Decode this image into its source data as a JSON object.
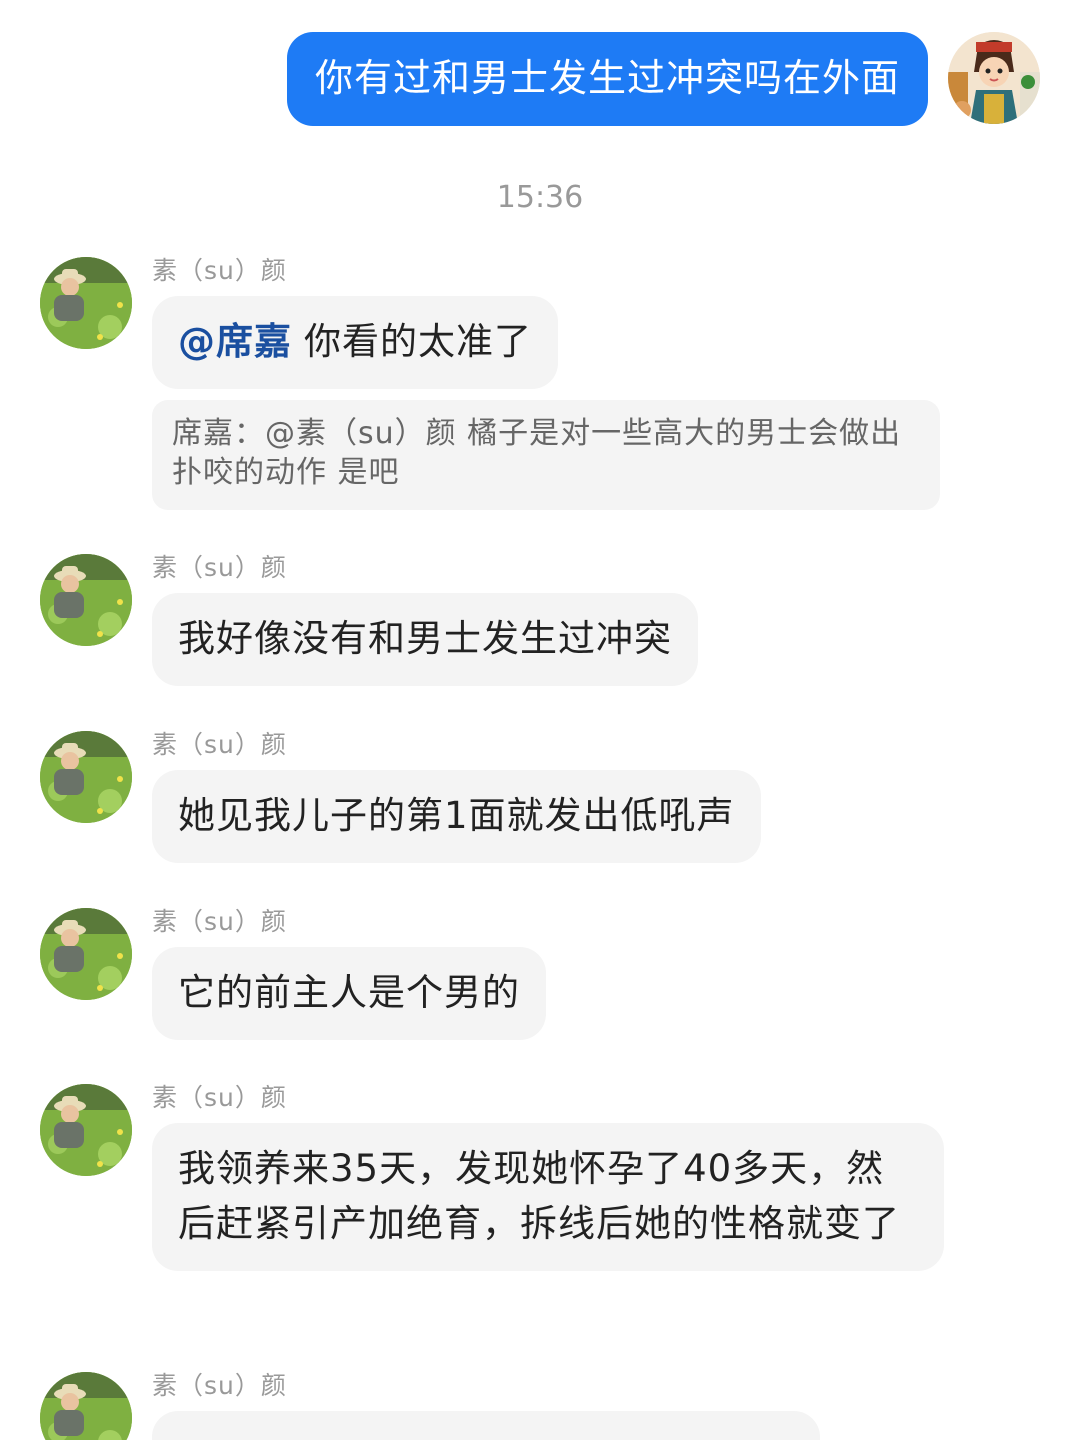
{
  "outgoing": {
    "text": "你有过和男士发生过冲突吗在外面",
    "avatar_icon": "cartoon-girl-avatar-icon"
  },
  "timestamp": "15:36",
  "messages": [
    {
      "sender": "素（su）颜",
      "mention": "@席嘉",
      "text": "你看的太准了",
      "quote": "席嘉：@素（su）颜 橘子是对一些高大的男士会做出扑咬的动作 是吧"
    },
    {
      "sender": "素（su）颜",
      "text": "我好像没有和男士发生过冲突"
    },
    {
      "sender": "素（su）颜",
      "text": "她见我儿子的第1面就发出低吼声"
    },
    {
      "sender": "素（su）颜",
      "text": "它的前主人是个男的"
    },
    {
      "sender": "素（su）颜",
      "text": "我领养来35天，发现她怀孕了40多天，然后赶紧引产加绝育，拆线后她的性格就变了"
    },
    {
      "sender": "素（su）颜",
      "text": ""
    }
  ],
  "colors": {
    "outgoing_bubble": "#1e7bf5",
    "incoming_bubble": "#f4f4f4",
    "mention": "#1a4fa0"
  }
}
